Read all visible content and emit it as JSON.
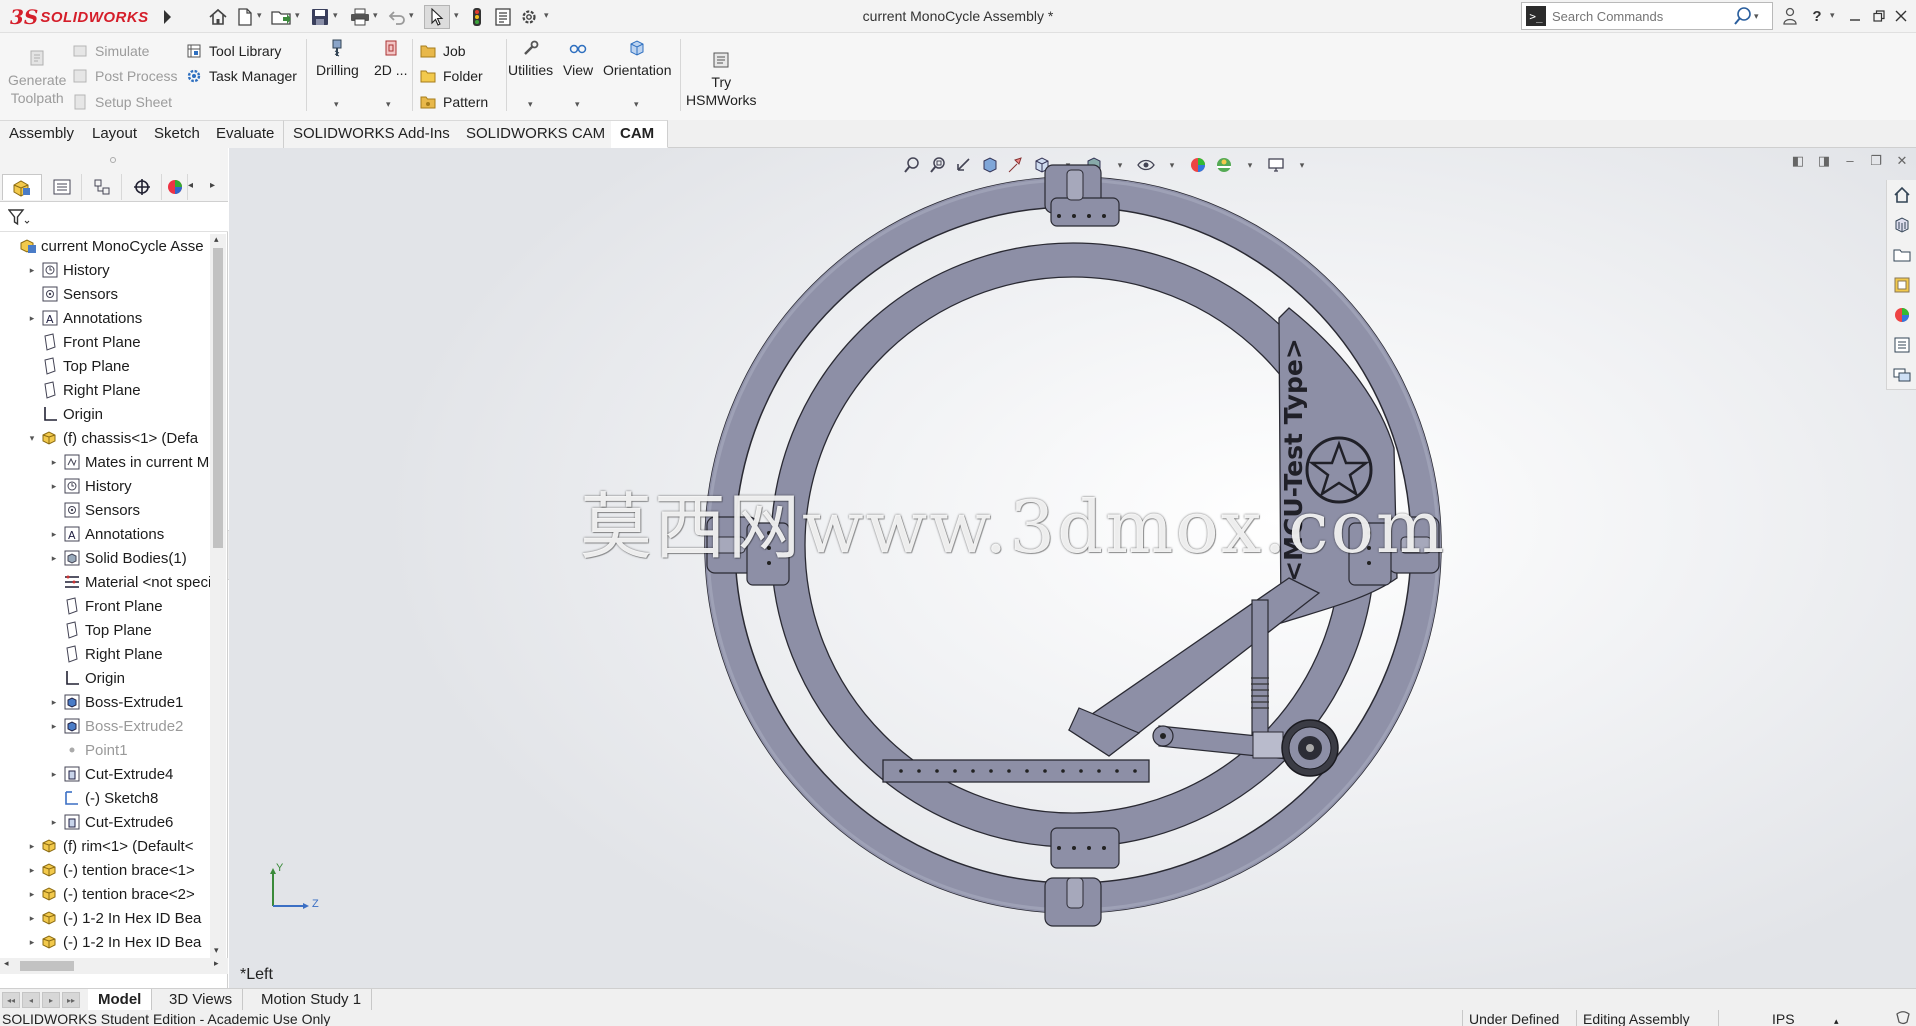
{
  "app": {
    "brand_ds": "3S",
    "brand_name": "SOLIDWORKS",
    "document_title": "current MonoCycle Assembly *",
    "search_placeholder": "Search Commands",
    "help_label": "?"
  },
  "command_manager": {
    "generate_toolpath_line1": "Generate",
    "generate_toolpath_line2": "Toolpath",
    "simulate": "Simulate",
    "post_process": "Post Process",
    "setup_sheet": "Setup Sheet",
    "tool_library": "Tool Library",
    "task_manager": "Task Manager",
    "drilling": "Drilling",
    "two_d": "2D ...",
    "job": "Job",
    "folder": "Folder",
    "pattern": "Pattern",
    "utilities": "Utilities",
    "view": "View",
    "orientation": "Orientation",
    "try_line1": "Try",
    "try_line2": "HSMWorks"
  },
  "tabs": [
    "Assembly",
    "Layout",
    "Sketch",
    "Evaluate",
    "SOLIDWORKS Add-Ins",
    "SOLIDWORKS CAM",
    "CAM"
  ],
  "active_tab": "CAM",
  "tree": [
    {
      "label": "current MonoCycle Asse",
      "icon": "assembly-icon",
      "expander": ""
    },
    {
      "label": "History",
      "icon": "history-icon",
      "expander": "▸"
    },
    {
      "label": "Sensors",
      "icon": "sensors-icon",
      "expander": ""
    },
    {
      "label": "Annotations",
      "icon": "annotations-icon",
      "expander": "▸"
    },
    {
      "label": "Front Plane",
      "icon": "plane-icon",
      "expander": ""
    },
    {
      "label": "Top Plane",
      "icon": "plane-icon",
      "expander": ""
    },
    {
      "label": "Right Plane",
      "icon": "plane-icon",
      "expander": ""
    },
    {
      "label": "Origin",
      "icon": "origin-icon",
      "expander": ""
    },
    {
      "label": "(f) chassis<1> (Defa",
      "icon": "part-icon",
      "expander": "▾"
    },
    {
      "label": "Mates in current Mo",
      "icon": "mates-icon",
      "expander": "▸"
    },
    {
      "label": "History",
      "icon": "history-icon",
      "expander": "▸"
    },
    {
      "label": "Sensors",
      "icon": "sensors-icon",
      "expander": ""
    },
    {
      "label": "Annotations",
      "icon": "annotations-icon",
      "expander": "▸"
    },
    {
      "label": "Solid Bodies(1)",
      "icon": "solid-bodies-icon",
      "expander": "▸"
    },
    {
      "label": "Material <not specifi",
      "icon": "material-icon",
      "expander": ""
    },
    {
      "label": "Front Plane",
      "icon": "plane-icon",
      "expander": ""
    },
    {
      "label": "Top Plane",
      "icon": "plane-icon",
      "expander": ""
    },
    {
      "label": "Right Plane",
      "icon": "plane-icon",
      "expander": ""
    },
    {
      "label": "Origin",
      "icon": "origin-icon",
      "expander": ""
    },
    {
      "label": "Boss-Extrude1",
      "icon": "extrude-icon",
      "expander": "▸"
    },
    {
      "label": "Boss-Extrude2",
      "icon": "extrude-icon",
      "expander": "▸"
    },
    {
      "label": "Point1",
      "icon": "point-icon",
      "expander": ""
    },
    {
      "label": "Cut-Extrude4",
      "icon": "cut-icon",
      "expander": "▸"
    },
    {
      "label": "(-) Sketch8",
      "icon": "sketch-icon",
      "expander": ""
    },
    {
      "label": "Cut-Extrude6",
      "icon": "cut-icon",
      "expander": "▸"
    },
    {
      "label": "(f) rim<1> (Default<",
      "icon": "part-icon",
      "expander": "▸"
    },
    {
      "label": "(-) tention brace<1>",
      "icon": "part-icon",
      "expander": "▸"
    },
    {
      "label": "(-) tention brace<2>",
      "icon": "part-icon",
      "expander": "▸"
    },
    {
      "label": "(-) 1-2 In Hex ID Bea",
      "icon": "part-icon",
      "expander": "▸"
    },
    {
      "label": "(-) 1-2 In Hex ID Bea",
      "icon": "part-icon",
      "expander": "▸"
    }
  ],
  "viewport": {
    "model_text": "<MCU-Test Type>",
    "watermark": "莫西网www.3dmox.com",
    "view_name": "*Left",
    "triad_y": "Y",
    "triad_z": "Z"
  },
  "bottom_tabs": [
    "Model",
    "3D Views",
    "Motion Study 1"
  ],
  "active_bottom_tab": "Model",
  "status": {
    "edition": "SOLIDWORKS Student Edition - Academic Use Only",
    "definition": "Under Defined",
    "mode": "Editing Assembly",
    "units": "IPS"
  },
  "colors": {
    "brand_red": "#d51e2a",
    "model_gray": "#8d8fa6",
    "model_dark": "#6f7189"
  }
}
